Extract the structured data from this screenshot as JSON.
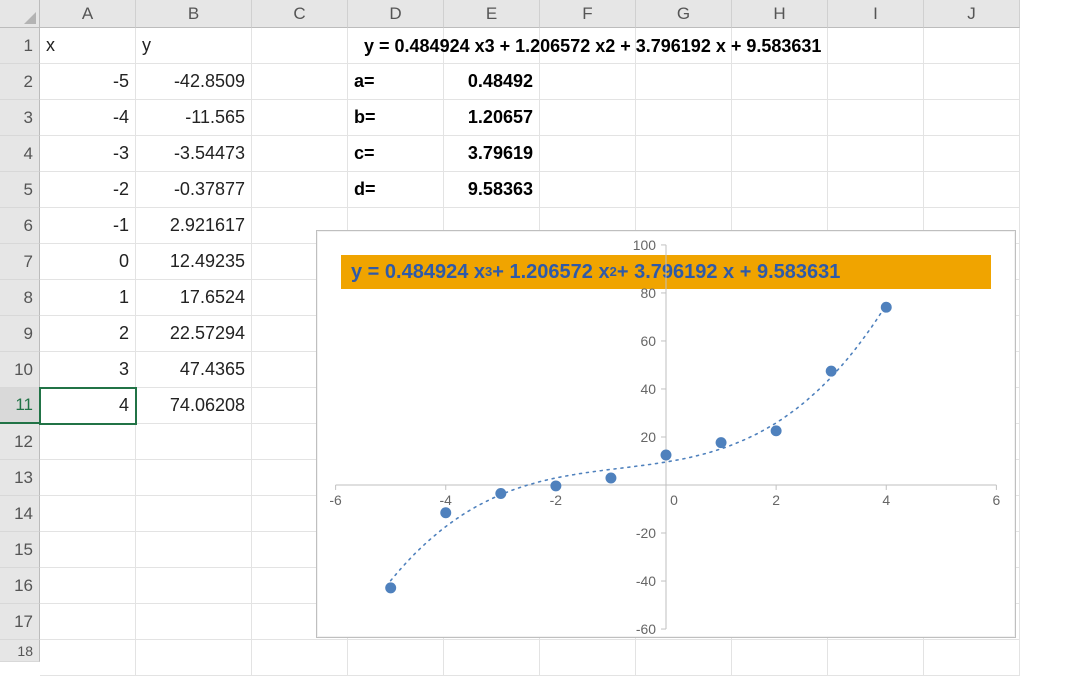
{
  "columns": [
    "A",
    "B",
    "C",
    "D",
    "E",
    "F",
    "G",
    "H",
    "I",
    "J"
  ],
  "rows": [
    "1",
    "2",
    "3",
    "4",
    "5",
    "6",
    "7",
    "8",
    "9",
    "10",
    "11",
    "12",
    "13",
    "14",
    "15",
    "16",
    "17",
    "18"
  ],
  "header": {
    "x": "x",
    "y": "y"
  },
  "xvals": [
    -5,
    -4,
    -3,
    -2,
    -1,
    0,
    1,
    2,
    3,
    4
  ],
  "yvals": [
    "-42.8509",
    "-11.565",
    "-3.54473",
    "-0.37877",
    "2.921617",
    "12.49235",
    "17.6524",
    "22.57294",
    "47.4365",
    "74.06208"
  ],
  "coeff_labels": {
    "a": "a=",
    "b": "b=",
    "c": "c=",
    "d": "d="
  },
  "coeff_vals": {
    "a": "0.48492",
    "b": "1.20657",
    "c": "3.79619",
    "d": "9.58363"
  },
  "formula_text": "y = 0.484924 x3 + 1.206572 x2 + 3.796192 x + 9.583631",
  "chart_title_html": "y = 0.484924 x<sup class='sup'>3</sup> + 1.206572 x<sup class='sup'>2</sup> + 3.796192 x + 9.583631",
  "chart_data": {
    "type": "scatter",
    "title": "y = 0.484924 x^3 + 1.206572 x^2 + 3.796192 x + 9.583631",
    "xlabel": "",
    "ylabel": "",
    "x": [
      -5,
      -4,
      -3,
      -2,
      -1,
      0,
      1,
      2,
      3,
      4
    ],
    "y": [
      -42.85,
      -11.57,
      -3.54,
      -0.38,
      2.92,
      12.49,
      17.65,
      22.57,
      47.44,
      74.06
    ],
    "xlim": [
      -6,
      6
    ],
    "ylim": [
      -60,
      100
    ],
    "xticks": [
      -6,
      -4,
      -2,
      0,
      2,
      4,
      6
    ],
    "yticks": [
      -60,
      -40,
      -20,
      0,
      20,
      40,
      60,
      80,
      100
    ],
    "trendline": {
      "type": "polynomial",
      "degree": 3,
      "coeffs": {
        "a": 0.484924,
        "b": 1.206572,
        "c": 3.796192,
        "d": 9.583631
      },
      "style": "dotted",
      "color": "#4f81bd"
    }
  },
  "colors": {
    "accent": "#f0a400",
    "series": "#4f81bd",
    "selection": "#217346"
  }
}
